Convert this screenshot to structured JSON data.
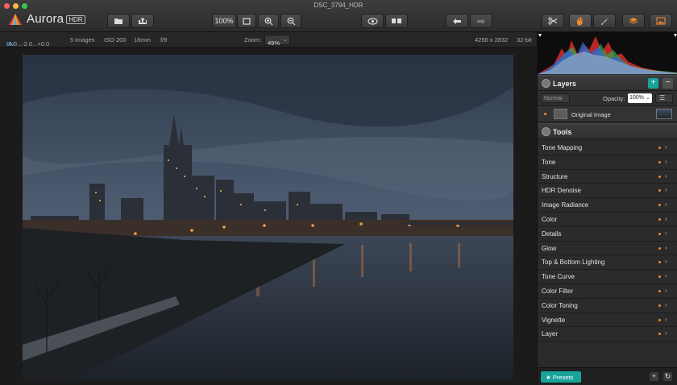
{
  "window": {
    "title": "DSC_3794_HDR"
  },
  "app": {
    "name": "Aurora",
    "badge": "HDR"
  },
  "toolbar": {
    "zoom_fit_label": "100%"
  },
  "infobar": {
    "ev_label": "EV",
    "ev_values": "-4.0...-2.0...+0.0",
    "images": "5 images",
    "iso": "ISO 200",
    "focal": "18mm",
    "aperture": "f/9",
    "zoom_label": "Zoom:",
    "zoom_value": "49%",
    "dimensions": "4256 x 2832",
    "bitdepth": "32-bit"
  },
  "layers": {
    "title": "Layers",
    "blend_mode": "Normal",
    "opacity_label": "Opacity:",
    "opacity_value": "100%",
    "items": [
      {
        "name": "Original Image"
      }
    ]
  },
  "tools": {
    "title": "Tools",
    "items": [
      "Tone Mapping",
      "Tone",
      "Structure",
      "HDR Denoise",
      "Image Radiance",
      "Color",
      "Details",
      "Glow",
      "Top & Bottom Lighting",
      "Tone Curve",
      "Color Filter",
      "Color Toning",
      "Vignette",
      "Layer"
    ]
  },
  "bottom": {
    "presets_label": "Presets"
  },
  "colors": {
    "accent": "#19a39a",
    "modified_dot": "#f08a24",
    "ev_blue": "#3fa9f5"
  }
}
